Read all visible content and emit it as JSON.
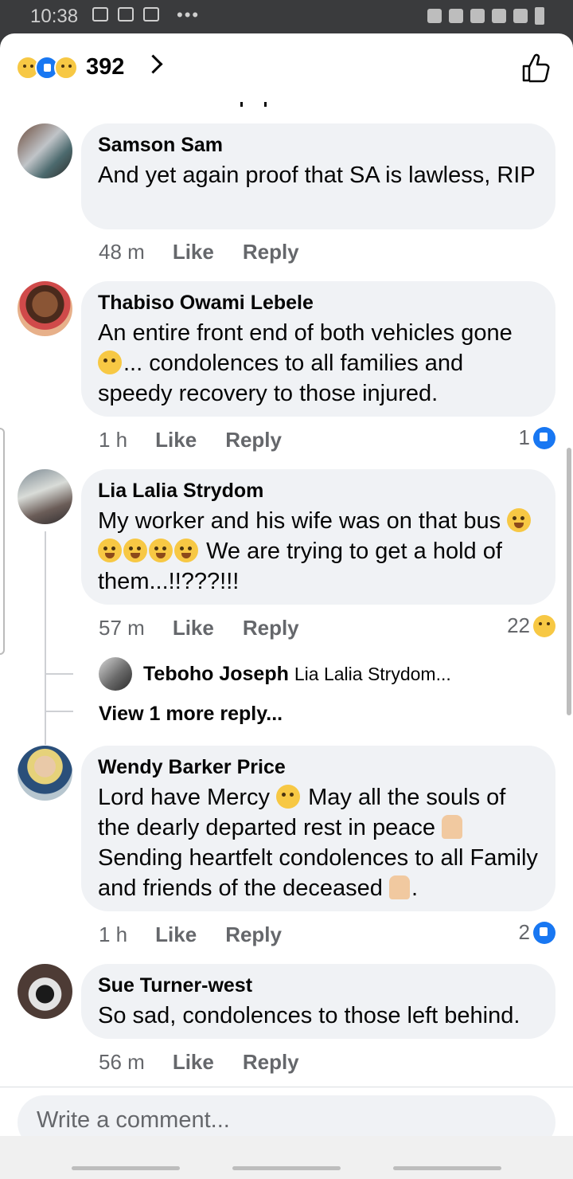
{
  "status_bar": {
    "time": "10:38",
    "dots": "•••"
  },
  "header": {
    "reaction_count": "392",
    "reaction_icons": [
      "sad-icon",
      "like-icon",
      "wow-icon"
    ]
  },
  "comments": [
    {
      "author": "Samson Sam",
      "text": "And yet again proof that SA is lawless, RIP",
      "time": "48 m",
      "like_label": "Like",
      "reply_label": "Reply",
      "reactions": ""
    },
    {
      "author": "Thabiso Owami Lebele",
      "text_before": "An entire front end of both vehicles gone",
      "text_after": "... condolences to all families and speedy recovery to those injured.",
      "time": "1 h",
      "like_label": "Like",
      "reply_label": "Reply",
      "reactions": "1"
    },
    {
      "author": "Lia Lalia Strydom",
      "text_before": "My worker and his wife was on that bus",
      "text_after": "We are trying to get a hold of them...!!???!!!",
      "time": "57 m",
      "like_label": "Like",
      "reply_label": "Reply",
      "reactions": "22"
    },
    {
      "author": "Wendy Barker Price",
      "text_1": "Lord have Mercy",
      "text_2": "May all the souls of the dearly departed rest in peace",
      "text_3": "Sending heartfelt condolences to all Family and friends of the deceased",
      "text_4": ".",
      "time": "1 h",
      "like_label": "Like",
      "reply_label": "Reply",
      "reactions": "2"
    },
    {
      "author": "Sue Turner-west",
      "text": "So sad, condolences to those left behind.",
      "time": "56 m",
      "like_label": "Like",
      "reply_label": "Reply",
      "reactions": ""
    }
  ],
  "reply_preview": {
    "author": "Teboho Joseph",
    "snippet": "Lia Lalia Strydom..."
  },
  "view_more": "View 1 more reply...",
  "composer": {
    "placeholder": "Write a comment..."
  },
  "colors": {
    "accent": "#1877f2",
    "bubble": "#f0f2f5",
    "meta": "#65676b"
  }
}
